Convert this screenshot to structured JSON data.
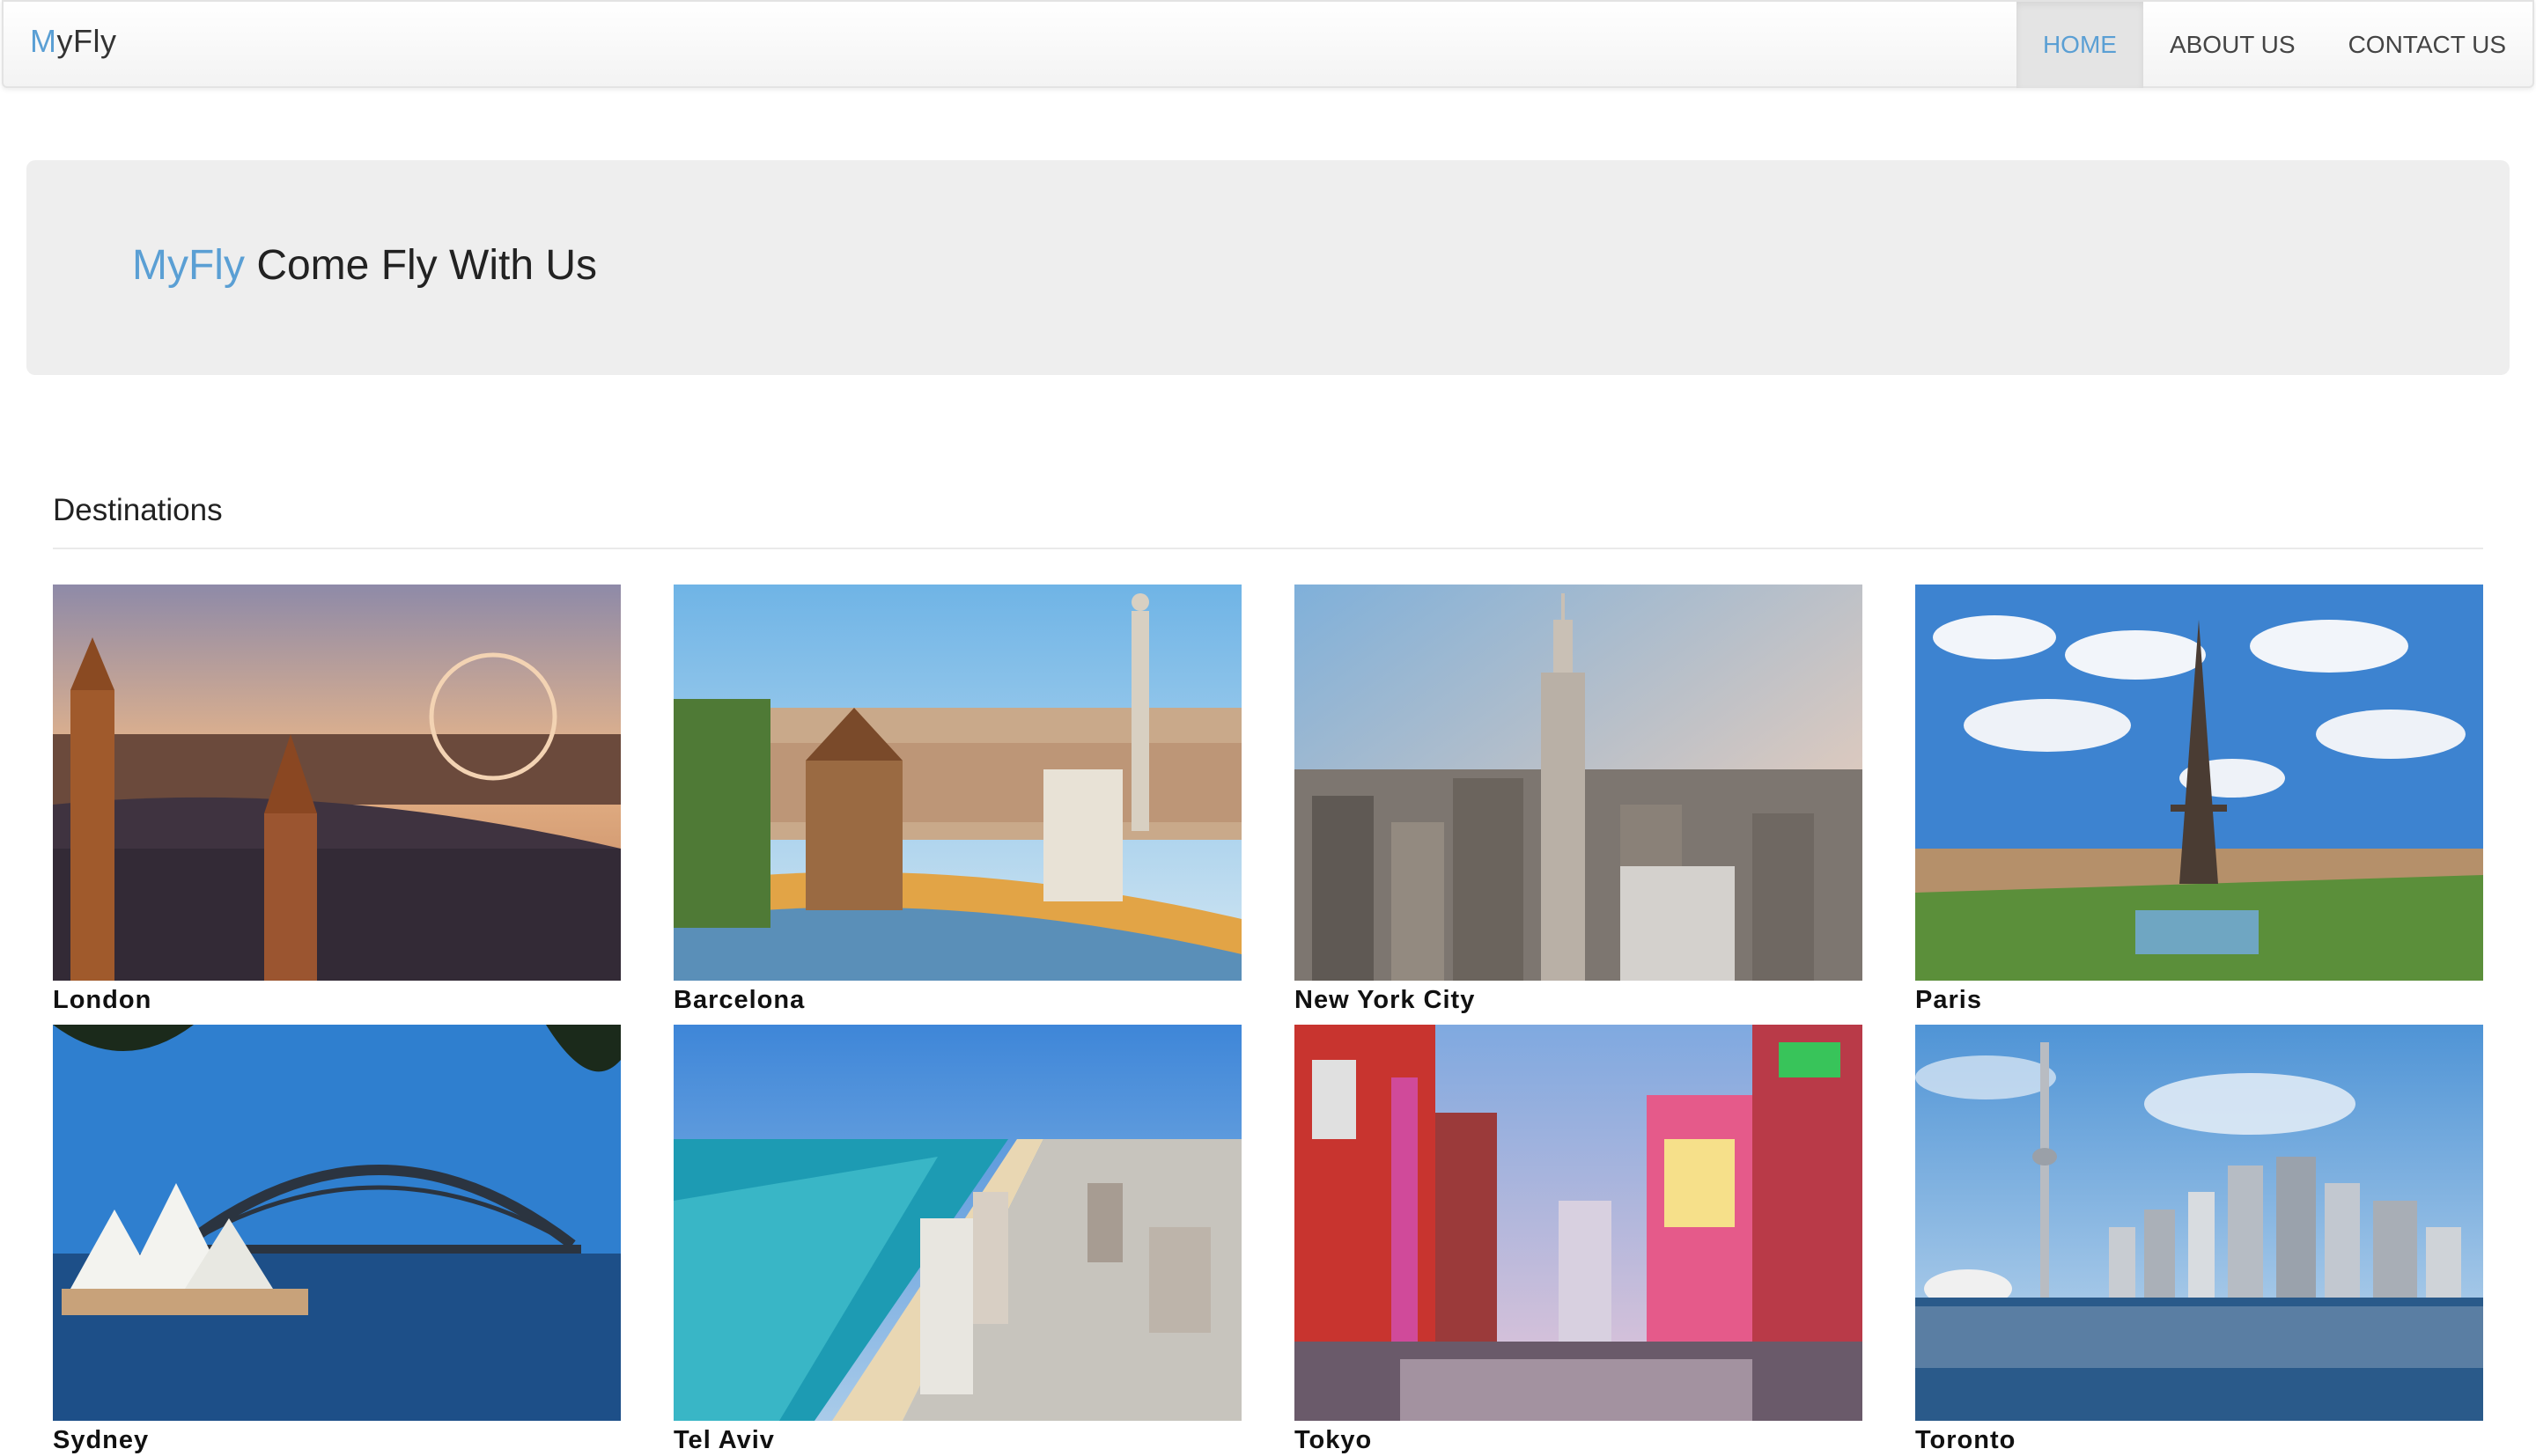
{
  "nav": {
    "brand_prefix": "M",
    "brand_rest": "yFly",
    "items": [
      {
        "label": "HOME",
        "active": true
      },
      {
        "label": "ABOUT US",
        "active": false
      },
      {
        "label": "CONTACT US",
        "active": false
      }
    ]
  },
  "hero": {
    "brand": "MyFly",
    "tagline": "Come Fly With Us"
  },
  "destinations": {
    "heading": "Destinations",
    "items": [
      {
        "name": "London"
      },
      {
        "name": "Barcelona"
      },
      {
        "name": "New York City"
      },
      {
        "name": "Paris"
      },
      {
        "name": "Sydney"
      },
      {
        "name": "Tel Aviv"
      },
      {
        "name": "Tokyo"
      },
      {
        "name": "Toronto"
      }
    ]
  },
  "colors": {
    "accent": "#5a9fd4",
    "jumbotron_bg": "#eeeeee"
  }
}
